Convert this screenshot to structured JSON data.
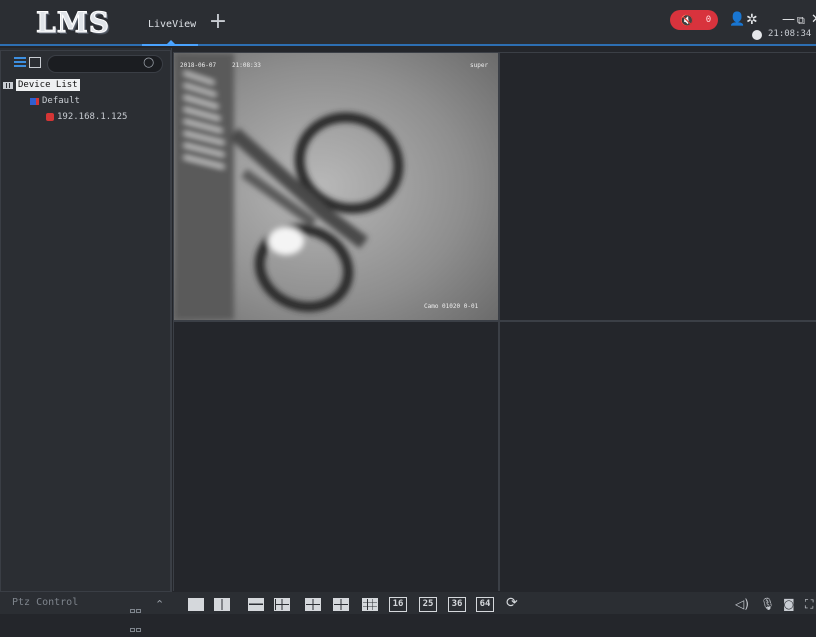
{
  "app": {
    "logo_text": "LMS"
  },
  "tabs": [
    {
      "label": "LiveView",
      "active": true
    }
  ],
  "header": {
    "alarm_count": "0",
    "time": "21:08:34",
    "colors": {
      "alarm_pill": "#d8333d",
      "accent": "#2d6fb3"
    }
  },
  "sidebar": {
    "search_placeholder": "",
    "tree": {
      "root_label": "Device List",
      "group_label": "Default",
      "device_label": "192.168.1.125"
    }
  },
  "video": {
    "channels": [
      {
        "osd_date": "2018-06-07",
        "osd_time": "21:08:33",
        "osd_user": "super",
        "osd_camera": "Camo 01020 0-01"
      },
      {
        "empty": true
      },
      {
        "empty": true
      },
      {
        "empty": true
      }
    ]
  },
  "bottom": {
    "ptz_label": "Ptz Control",
    "layouts": [
      "16",
      "25",
      "36",
      "64"
    ]
  }
}
